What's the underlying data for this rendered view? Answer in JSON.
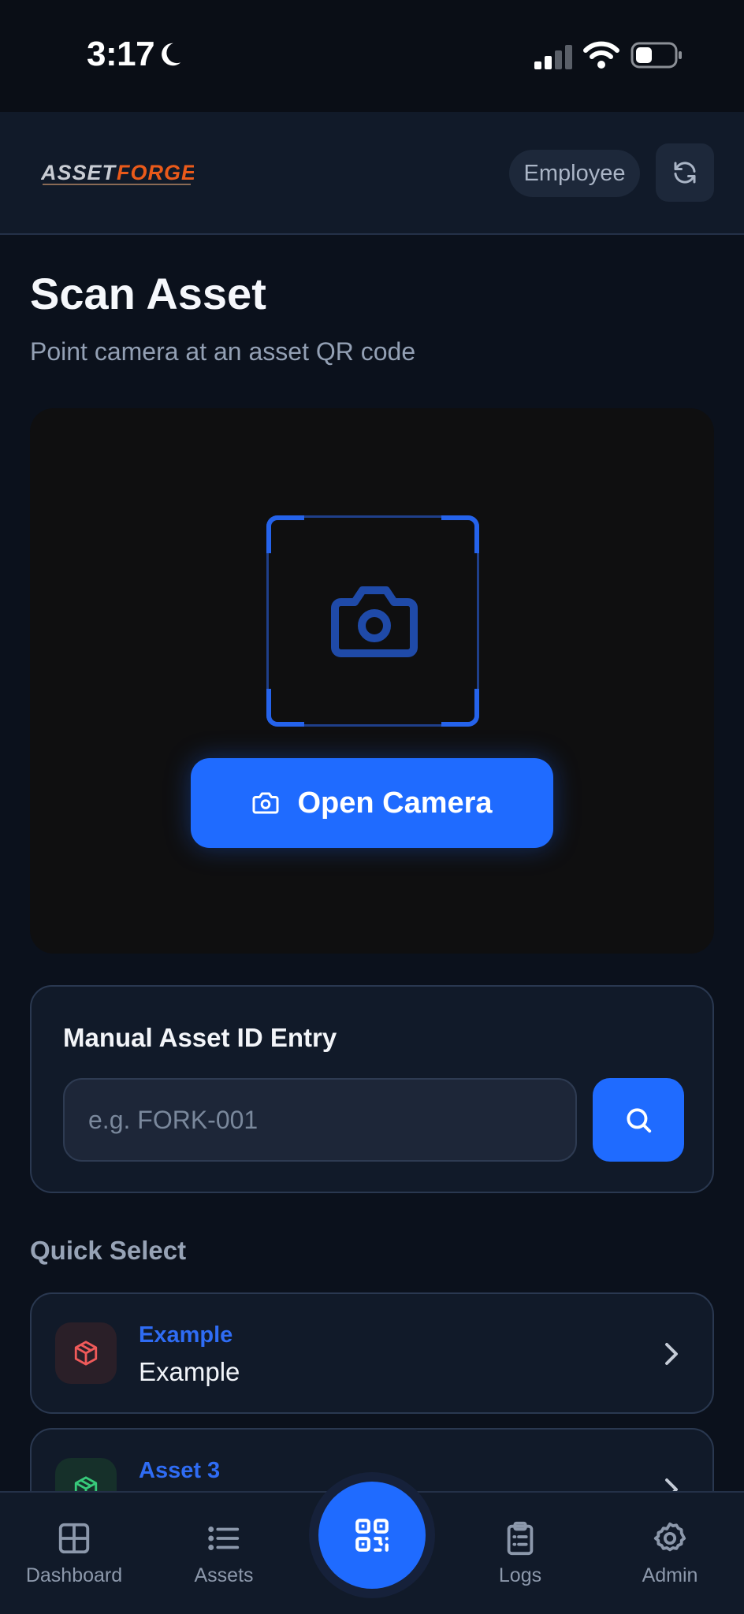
{
  "status_bar": {
    "time": "3:17"
  },
  "header": {
    "logo_text_first": "ASSET",
    "logo_text_second": "FORGE",
    "role_badge": "Employee"
  },
  "page": {
    "title": "Scan Asset",
    "subtitle": "Point camera at an asset QR code"
  },
  "camera": {
    "open_label": "Open Camera"
  },
  "manual_entry": {
    "title": "Manual Asset ID Entry",
    "placeholder": "e.g. FORK-001",
    "value": ""
  },
  "quick_select": {
    "label": "Quick Select",
    "items": [
      {
        "id": "Example",
        "name": "Example",
        "icon": "package-icon",
        "color": "#ef5a5a"
      },
      {
        "id": "Asset 3",
        "name": "",
        "icon": "package-icon",
        "color": "#37c97a"
      }
    ]
  },
  "tabs": [
    {
      "label": "Dashboard",
      "icon": "grid-icon"
    },
    {
      "label": "Assets",
      "icon": "list-icon"
    },
    {
      "label": "",
      "icon": "qr-code-icon"
    },
    {
      "label": "Logs",
      "icon": "clipboard-icon"
    },
    {
      "label": "Admin",
      "icon": "gear-icon"
    }
  ],
  "colors": {
    "accent": "#1f6bff",
    "background": "#0b111c",
    "card": "#111a29",
    "logo_orange": "#ea5a1a"
  }
}
